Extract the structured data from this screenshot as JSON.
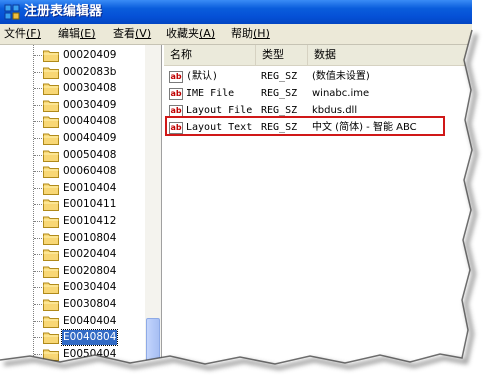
{
  "window": {
    "title": "注册表编辑器"
  },
  "menu": [
    {
      "label": "文件",
      "accel": "(F)"
    },
    {
      "label": "编辑",
      "accel": "(E)"
    },
    {
      "label": "查看",
      "accel": "(V)"
    },
    {
      "label": "收藏夹",
      "accel": "(A)"
    },
    {
      "label": "帮助",
      "accel": "(H)"
    }
  ],
  "tree": {
    "items": [
      "00020409",
      "0002083b",
      "00030408",
      "00030409",
      "00040408",
      "00040409",
      "00050408",
      "00060408",
      "E0010404",
      "E0010411",
      "E0010412",
      "E0010804",
      "E0020404",
      "E0020804",
      "E0030404",
      "E0030804",
      "E0040404",
      "E0040804",
      "E0050404"
    ],
    "selected": "E0040804"
  },
  "list": {
    "columns": {
      "name": "名称",
      "type": "类型",
      "data": "数据"
    },
    "rows": [
      {
        "name": "(默认)",
        "type": "REG_SZ",
        "data": "(数值未设置)",
        "icon": "string-value-icon"
      },
      {
        "name": "IME File",
        "type": "REG_SZ",
        "data": "winabc.ime",
        "icon": "string-value-icon"
      },
      {
        "name": "Layout File",
        "type": "REG_SZ",
        "data": "kbdus.dll",
        "icon": "string-value-icon"
      },
      {
        "name": "Layout Text",
        "type": "REG_SZ",
        "data": "中文 (简体) - 智能 ABC",
        "icon": "string-value-icon"
      }
    ],
    "highlighted_row": "Layout Text"
  },
  "colors": {
    "titlebar": "#0550d6",
    "highlight": "#d01818",
    "selection": "#316ac5"
  }
}
